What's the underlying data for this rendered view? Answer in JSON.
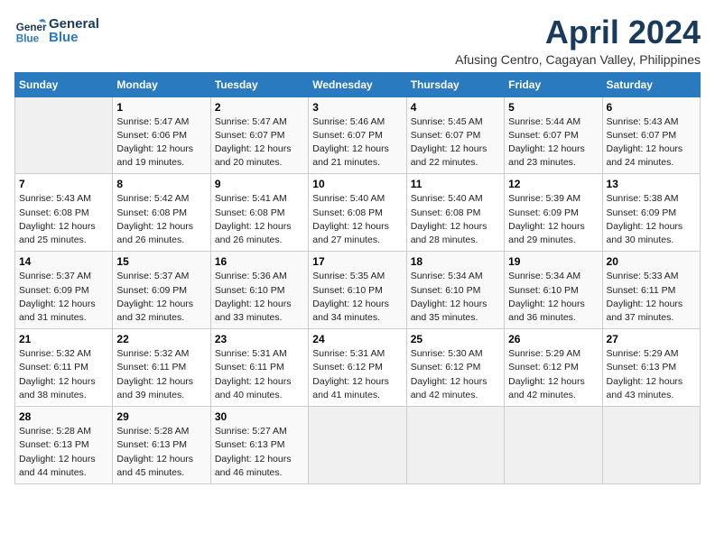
{
  "header": {
    "logo_general": "General",
    "logo_blue": "Blue",
    "title": "April 2024",
    "subtitle": "Afusing Centro, Cagayan Valley, Philippines"
  },
  "weekdays": [
    "Sunday",
    "Monday",
    "Tuesday",
    "Wednesday",
    "Thursday",
    "Friday",
    "Saturday"
  ],
  "weeks": [
    [
      {
        "day": "",
        "info": ""
      },
      {
        "day": "1",
        "info": "Sunrise: 5:47 AM\nSunset: 6:06 PM\nDaylight: 12 hours\nand 19 minutes."
      },
      {
        "day": "2",
        "info": "Sunrise: 5:47 AM\nSunset: 6:07 PM\nDaylight: 12 hours\nand 20 minutes."
      },
      {
        "day": "3",
        "info": "Sunrise: 5:46 AM\nSunset: 6:07 PM\nDaylight: 12 hours\nand 21 minutes."
      },
      {
        "day": "4",
        "info": "Sunrise: 5:45 AM\nSunset: 6:07 PM\nDaylight: 12 hours\nand 22 minutes."
      },
      {
        "day": "5",
        "info": "Sunrise: 5:44 AM\nSunset: 6:07 PM\nDaylight: 12 hours\nand 23 minutes."
      },
      {
        "day": "6",
        "info": "Sunrise: 5:43 AM\nSunset: 6:07 PM\nDaylight: 12 hours\nand 24 minutes."
      }
    ],
    [
      {
        "day": "7",
        "info": "Sunrise: 5:43 AM\nSunset: 6:08 PM\nDaylight: 12 hours\nand 25 minutes."
      },
      {
        "day": "8",
        "info": "Sunrise: 5:42 AM\nSunset: 6:08 PM\nDaylight: 12 hours\nand 26 minutes."
      },
      {
        "day": "9",
        "info": "Sunrise: 5:41 AM\nSunset: 6:08 PM\nDaylight: 12 hours\nand 26 minutes."
      },
      {
        "day": "10",
        "info": "Sunrise: 5:40 AM\nSunset: 6:08 PM\nDaylight: 12 hours\nand 27 minutes."
      },
      {
        "day": "11",
        "info": "Sunrise: 5:40 AM\nSunset: 6:08 PM\nDaylight: 12 hours\nand 28 minutes."
      },
      {
        "day": "12",
        "info": "Sunrise: 5:39 AM\nSunset: 6:09 PM\nDaylight: 12 hours\nand 29 minutes."
      },
      {
        "day": "13",
        "info": "Sunrise: 5:38 AM\nSunset: 6:09 PM\nDaylight: 12 hours\nand 30 minutes."
      }
    ],
    [
      {
        "day": "14",
        "info": "Sunrise: 5:37 AM\nSunset: 6:09 PM\nDaylight: 12 hours\nand 31 minutes."
      },
      {
        "day": "15",
        "info": "Sunrise: 5:37 AM\nSunset: 6:09 PM\nDaylight: 12 hours\nand 32 minutes."
      },
      {
        "day": "16",
        "info": "Sunrise: 5:36 AM\nSunset: 6:10 PM\nDaylight: 12 hours\nand 33 minutes."
      },
      {
        "day": "17",
        "info": "Sunrise: 5:35 AM\nSunset: 6:10 PM\nDaylight: 12 hours\nand 34 minutes."
      },
      {
        "day": "18",
        "info": "Sunrise: 5:34 AM\nSunset: 6:10 PM\nDaylight: 12 hours\nand 35 minutes."
      },
      {
        "day": "19",
        "info": "Sunrise: 5:34 AM\nSunset: 6:10 PM\nDaylight: 12 hours\nand 36 minutes."
      },
      {
        "day": "20",
        "info": "Sunrise: 5:33 AM\nSunset: 6:11 PM\nDaylight: 12 hours\nand 37 minutes."
      }
    ],
    [
      {
        "day": "21",
        "info": "Sunrise: 5:32 AM\nSunset: 6:11 PM\nDaylight: 12 hours\nand 38 minutes."
      },
      {
        "day": "22",
        "info": "Sunrise: 5:32 AM\nSunset: 6:11 PM\nDaylight: 12 hours\nand 39 minutes."
      },
      {
        "day": "23",
        "info": "Sunrise: 5:31 AM\nSunset: 6:11 PM\nDaylight: 12 hours\nand 40 minutes."
      },
      {
        "day": "24",
        "info": "Sunrise: 5:31 AM\nSunset: 6:12 PM\nDaylight: 12 hours\nand 41 minutes."
      },
      {
        "day": "25",
        "info": "Sunrise: 5:30 AM\nSunset: 6:12 PM\nDaylight: 12 hours\nand 42 minutes."
      },
      {
        "day": "26",
        "info": "Sunrise: 5:29 AM\nSunset: 6:12 PM\nDaylight: 12 hours\nand 42 minutes."
      },
      {
        "day": "27",
        "info": "Sunrise: 5:29 AM\nSunset: 6:13 PM\nDaylight: 12 hours\nand 43 minutes."
      }
    ],
    [
      {
        "day": "28",
        "info": "Sunrise: 5:28 AM\nSunset: 6:13 PM\nDaylight: 12 hours\nand 44 minutes."
      },
      {
        "day": "29",
        "info": "Sunrise: 5:28 AM\nSunset: 6:13 PM\nDaylight: 12 hours\nand 45 minutes."
      },
      {
        "day": "30",
        "info": "Sunrise: 5:27 AM\nSunset: 6:13 PM\nDaylight: 12 hours\nand 46 minutes."
      },
      {
        "day": "",
        "info": ""
      },
      {
        "day": "",
        "info": ""
      },
      {
        "day": "",
        "info": ""
      },
      {
        "day": "",
        "info": ""
      }
    ]
  ]
}
